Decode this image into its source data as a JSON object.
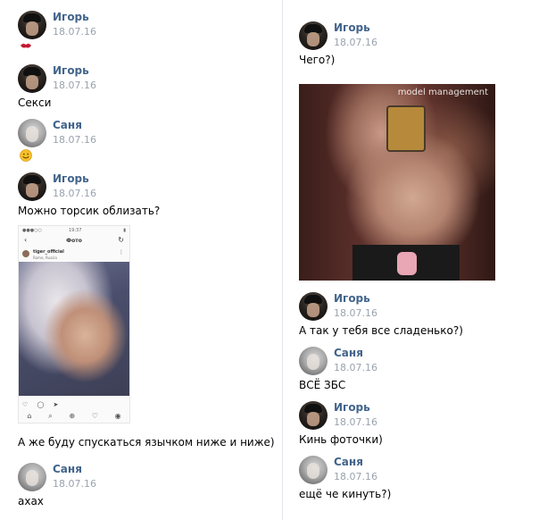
{
  "left": {
    "messages": [
      {
        "author": "Игорь",
        "date": "18.07.16",
        "emoji": "kiss-emoji"
      },
      {
        "author": "Игорь",
        "date": "18.07.16",
        "text": "Секси"
      },
      {
        "author": "Саня",
        "date": "18.07.16",
        "emoji": "smile-emoji"
      },
      {
        "author": "Игорь",
        "date": "18.07.16",
        "text": "Можно торсик облизать?"
      },
      {
        "text": "А же буду спускаться язычком ниже и ниже)"
      },
      {
        "author": "Саня",
        "date": "18.07.16",
        "text": "ахах"
      }
    ],
    "phone_screenshot": {
      "time": "19:37",
      "title": "Фото",
      "back": "‹",
      "refresh": "↻",
      "username": "tiger_official",
      "location": "Rome, Russia",
      "icons": "♡ ◯ ➤",
      "nav": [
        "⌂",
        "⌕",
        "⊕",
        "♡",
        "◉"
      ]
    }
  },
  "right": {
    "messages": [
      {
        "author": "Игорь",
        "date": "18.07.16",
        "text": "Чего?)"
      },
      {
        "author": "Игорь",
        "date": "18.07.16",
        "text": "А так у тебя все сладенько?)"
      },
      {
        "author": "Саня",
        "date": "18.07.16",
        "text": "ВСЁ ЗБС"
      },
      {
        "author": "Игорь",
        "date": "18.07.16",
        "text": "Кинь фоточки)"
      },
      {
        "author": "Саня",
        "date": "18.07.16",
        "text": "ещё че кинуть?)"
      }
    ],
    "photo_watermark": "model management"
  }
}
